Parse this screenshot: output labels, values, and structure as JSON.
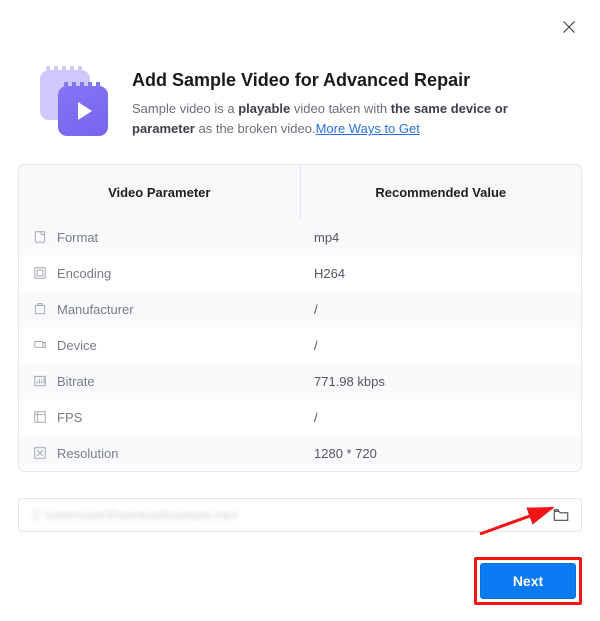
{
  "header": {
    "title": "Add Sample Video for Advanced Repair",
    "subtitle_prefix": "Sample video is a ",
    "subtitle_b1": "playable",
    "subtitle_mid": " video taken with ",
    "subtitle_b2": "the same device or parameter",
    "subtitle_suffix": " as the broken video.",
    "link_text": "More Ways to Get"
  },
  "table": {
    "header_left": "Video Parameter",
    "header_right": "Recommended Value",
    "rows": [
      {
        "label": "Format",
        "value": "mp4"
      },
      {
        "label": "Encoding",
        "value": "H264"
      },
      {
        "label": "Manufacturer",
        "value": "/"
      },
      {
        "label": "Device",
        "value": "/"
      },
      {
        "label": "Bitrate",
        "value": "771.98 kbps"
      },
      {
        "label": "FPS",
        "value": "/"
      },
      {
        "label": "Resolution",
        "value": "1280 * 720"
      }
    ]
  },
  "path": {
    "blurred_placeholder": "C:\\Users\\user\\Downloads\\sample.mp4"
  },
  "footer": {
    "next_label": "Next"
  }
}
